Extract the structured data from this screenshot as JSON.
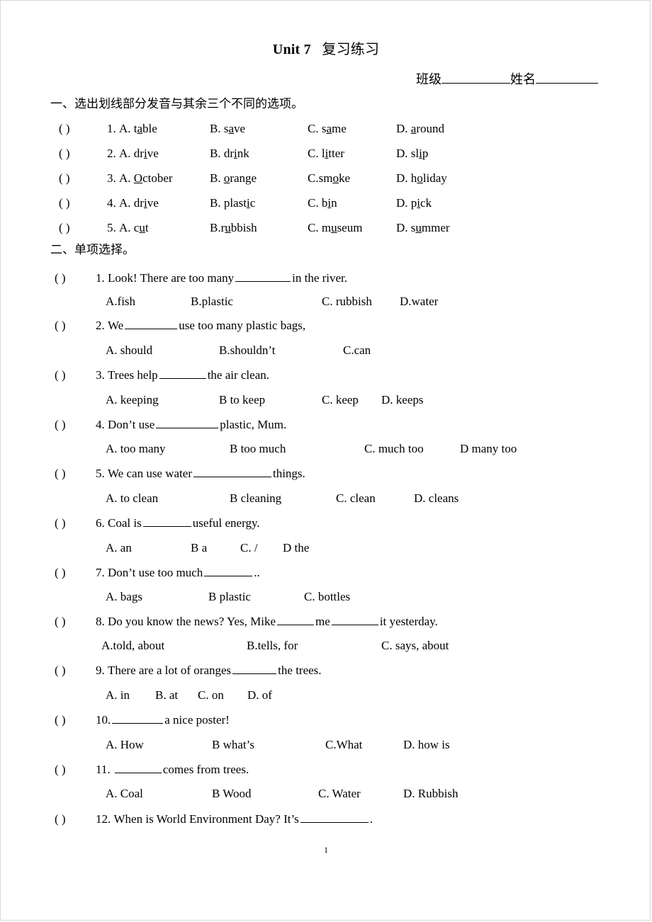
{
  "document": {
    "title_unit": "Unit 7",
    "title_cn": "复习练习",
    "meta_class_label": "班级",
    "meta_name_label": "姓名",
    "page_number": "1"
  },
  "section1": {
    "heading": "一、选出划线部分发音与其余三个不同的选项。",
    "paren": "(          )",
    "rows": [
      {
        "num": "1.",
        "a_pre": "A. t",
        "a_u": "a",
        "a_post": "ble",
        "b_pre": "B. s",
        "b_u": "a",
        "b_post": "ve",
        "c_pre": "C. s",
        "c_u": "a",
        "c_post": "me",
        "d_pre": "D. ",
        "d_u": "a",
        "d_post": "round"
      },
      {
        "num": "2.",
        "a_pre": "A. dr",
        "a_u": "i",
        "a_post": "ve",
        "b_pre": "B. dr",
        "b_u": "i",
        "b_post": "nk",
        "c_pre": "C. l",
        "c_u": "i",
        "c_post": "tter",
        "d_pre": "D. sl",
        "d_u": "i",
        "d_post": "p"
      },
      {
        "num": "3.",
        "a_pre": "A. ",
        "a_u": "O",
        "a_post": "ctober",
        "b_pre": "B. ",
        "b_u": "o",
        "b_post": "range",
        "c_pre": "C.sm",
        "c_u": "o",
        "c_post": "ke",
        "d_pre": "D. h",
        "d_u": "o",
        "d_post": "liday"
      },
      {
        "num": "4.",
        "a_pre": "A. dr",
        "a_u": "i",
        "a_post": "ve",
        "b_pre": "B. plast",
        "b_u": "i",
        "b_post": "c",
        "c_pre": "C. b",
        "c_u": "i",
        "c_post": "n",
        "d_pre": "D. p",
        "d_u": "i",
        "d_post": "ck"
      },
      {
        "num": "5.",
        "a_pre": "A. c",
        "a_u": "u",
        "a_post": "t",
        "b_pre": "B.r",
        "b_u": "u",
        "b_post": "bbish",
        "c_pre": "C. m",
        "c_u": "u",
        "c_post": "seum",
        "d_pre": "D. s",
        "d_u": "u",
        "d_post": "mmer"
      }
    ]
  },
  "section2": {
    "heading": "二、单项选择。",
    "paren": "(        )",
    "questions": [
      {
        "num": "1.",
        "stem_pre": "Look! There are too many",
        "stem_post": "in the river.",
        "options": [
          "A.fish",
          "B.plastic",
          "C. rubbish",
          "D.water"
        ]
      },
      {
        "num": "2.",
        "stem_pre": "We",
        "stem_post": "use too many plastic bags,",
        "options": [
          "A.   should",
          "B.shouldn’t",
          "C.can"
        ]
      },
      {
        "num": "3.",
        "stem_pre": "Trees help",
        "stem_post": "the air clean.",
        "options": [
          "A.   keeping",
          "B to keep",
          "C. keep",
          "D. keeps"
        ]
      },
      {
        "num": "4.",
        "stem_pre": "Don’t use",
        "stem_post": "plastic, Mum.",
        "options": [
          "A.   too many",
          "B too much",
          "C. much too",
          "D many too"
        ]
      },
      {
        "num": "5.",
        "stem_pre": "We can use water",
        "stem_post": "things.",
        "options": [
          "A.   to clean",
          "B cleaning",
          "C. clean",
          "D. cleans"
        ]
      },
      {
        "num": "6.",
        "stem_pre": "Coal is",
        "stem_post": "useful energy.",
        "options": [
          "A.   an",
          "B a",
          "C. /",
          "D the"
        ]
      },
      {
        "num": "7.",
        "stem_pre": "Don’t use too much",
        "stem_post": "..",
        "options": [
          "A.   bags",
          "B plastic",
          "C. bottles"
        ]
      },
      {
        "num": "8.",
        "stem_pre": "Do you know the news? Yes, Mike",
        "stem_mid": "me",
        "stem_post": "it yesterday.",
        "options": [
          "A.told, about",
          "B.tells, for",
          "C. says, about"
        ]
      },
      {
        "num": "9.",
        "stem_pre": "There are a lot of oranges",
        "stem_post": "the trees.",
        "options": [
          "A.   in",
          "B. at",
          "C. on",
          "D. of"
        ]
      },
      {
        "num": "10.",
        "stem_pre": "",
        "stem_post": "a nice poster!",
        "options": [
          "A.   How",
          "B what’s",
          "C.What",
          "D. how is"
        ]
      },
      {
        "num": "11.",
        "stem_pre": "",
        "stem_post": "comes from trees.",
        "options": [
          "A.   Coal",
          "B Wood",
          "C. Water",
          "D. Rubbish"
        ]
      },
      {
        "num": "12.",
        "stem_pre": "When is World Environment Day? It’s",
        "stem_post": ".",
        "options": []
      }
    ]
  }
}
